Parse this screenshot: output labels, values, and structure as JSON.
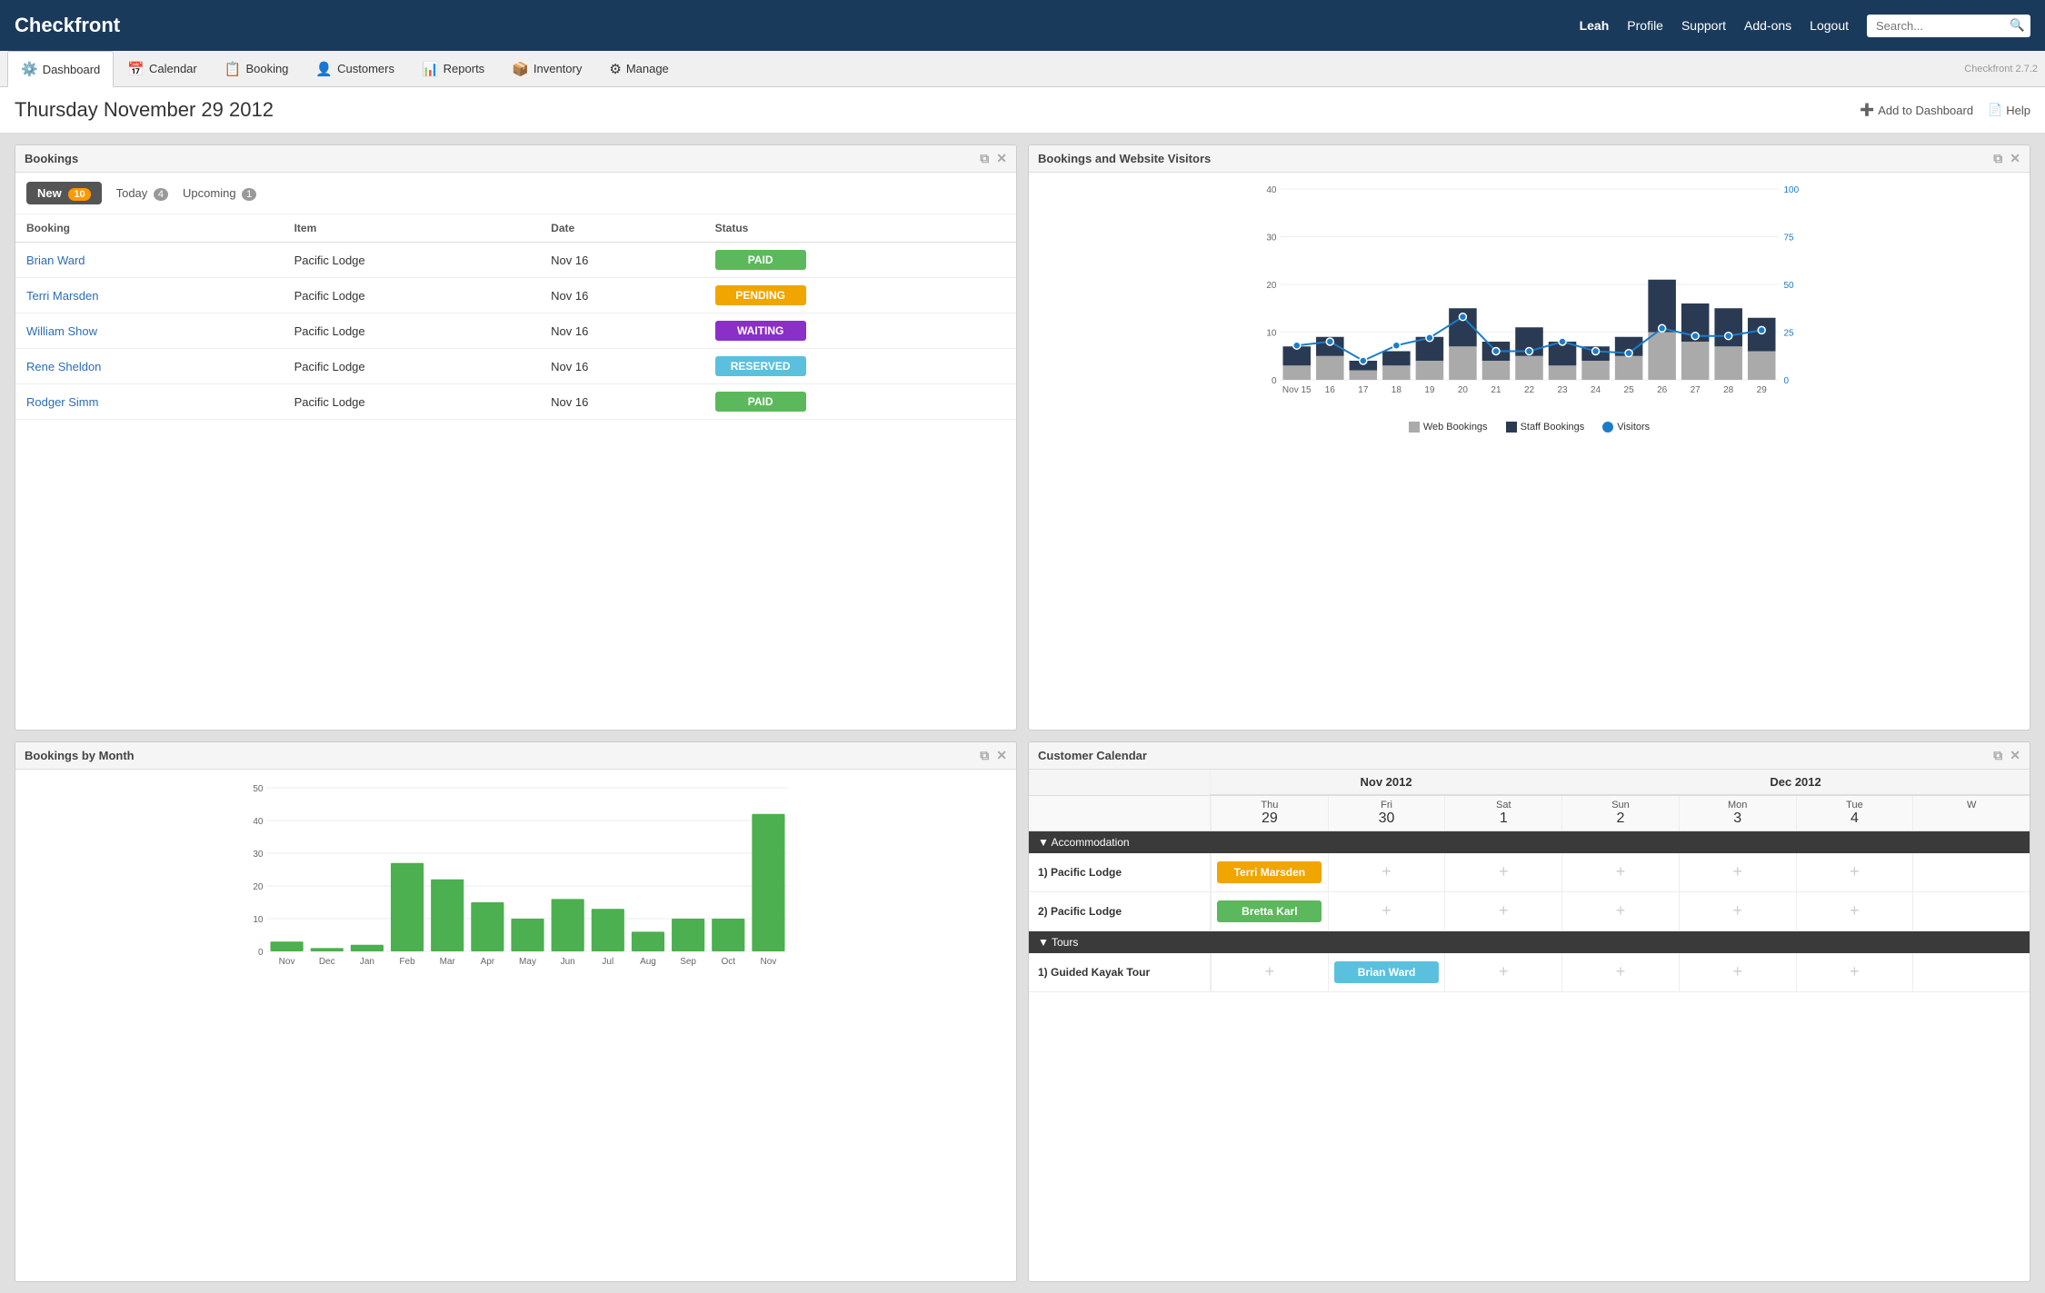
{
  "header": {
    "logo": "Checkfront",
    "username": "Leah",
    "nav": [
      "Profile",
      "Support",
      "Add-ons",
      "Logout"
    ],
    "search_placeholder": "Search..."
  },
  "navbar": {
    "tabs": [
      {
        "label": "Dashboard",
        "icon": "⚙",
        "active": true
      },
      {
        "label": "Calendar",
        "icon": "📅"
      },
      {
        "label": "Booking",
        "icon": "📋"
      },
      {
        "label": "Customers",
        "icon": "👤"
      },
      {
        "label": "Reports",
        "icon": "📊"
      },
      {
        "label": "Inventory",
        "icon": "📦"
      },
      {
        "label": "Manage",
        "icon": "⚙"
      }
    ],
    "version": "Checkfront 2.7.2"
  },
  "page": {
    "title": "Thursday November 29 2012",
    "add_to_dashboard": "Add to Dashboard",
    "help": "Help"
  },
  "bookings_widget": {
    "title": "Bookings",
    "tabs": [
      {
        "label": "New",
        "badge": "10",
        "active": true
      },
      {
        "label": "Today",
        "badge": "4"
      },
      {
        "label": "Upcoming",
        "badge": "1"
      }
    ],
    "columns": [
      "Booking",
      "Item",
      "Date",
      "Status"
    ],
    "rows": [
      {
        "booking": "Brian Ward",
        "item": "Pacific Lodge",
        "date": "Nov 16",
        "status": "PAID",
        "status_class": "status-paid"
      },
      {
        "booking": "Terri Marsden",
        "item": "Pacific Lodge",
        "date": "Nov 16",
        "status": "PENDING",
        "status_class": "status-pending"
      },
      {
        "booking": "William Show",
        "item": "Pacific Lodge",
        "date": "Nov 16",
        "status": "WAITING",
        "status_class": "status-waiting"
      },
      {
        "booking": "Rene Sheldon",
        "item": "Pacific Lodge",
        "date": "Nov 16",
        "status": "RESERVED",
        "status_class": "status-reserved"
      },
      {
        "booking": "Rodger Simm",
        "item": "Pacific Lodge",
        "date": "Nov 16",
        "status": "PAID",
        "status_class": "status-paid"
      }
    ]
  },
  "visitors_chart": {
    "title": "Bookings and Website Visitors",
    "labels": [
      "Nov 15",
      "16",
      "17",
      "18",
      "19",
      "20",
      "21",
      "22",
      "23",
      "24",
      "25",
      "26",
      "27",
      "28",
      "29"
    ],
    "left_axis": [
      0,
      10,
      20,
      30,
      40
    ],
    "right_axis": [
      0,
      25,
      50,
      75,
      100
    ],
    "legend": [
      "Web Bookings",
      "Staff Bookings",
      "Visitors"
    ],
    "bar_data_web": [
      3,
      5,
      2,
      3,
      4,
      7,
      4,
      5,
      3,
      4,
      5,
      10,
      8,
      7,
      6
    ],
    "bar_data_staff": [
      4,
      4,
      2,
      3,
      5,
      8,
      4,
      6,
      5,
      3,
      4,
      11,
      8,
      8,
      7
    ],
    "visitors_data": [
      18,
      20,
      10,
      18,
      22,
      33,
      15,
      15,
      20,
      15,
      14,
      27,
      23,
      23,
      26
    ]
  },
  "monthly_chart": {
    "title": "Bookings by Month",
    "labels": [
      "Nov",
      "Dec",
      "Jan",
      "Feb",
      "Mar",
      "Apr",
      "May",
      "Jun",
      "Jul",
      "Aug",
      "Sep",
      "Oct",
      "Nov"
    ],
    "values": [
      3,
      1,
      2,
      27,
      22,
      15,
      10,
      16,
      13,
      6,
      10,
      10,
      42
    ],
    "y_axis": [
      0,
      10,
      20,
      30,
      40,
      50
    ]
  },
  "customer_calendar": {
    "title": "Customer Calendar",
    "month1": "Nov 2012",
    "month2": "Dec 2012",
    "days": [
      {
        "day": "Thu",
        "date": "29"
      },
      {
        "day": "Fri",
        "date": "30"
      },
      {
        "day": "Sat",
        "date": "1"
      },
      {
        "day": "Sun",
        "date": "2"
      },
      {
        "day": "Mon",
        "date": "3"
      },
      {
        "day": "Tue",
        "date": "4"
      },
      {
        "day": "W",
        "date": ""
      }
    ],
    "sections": [
      {
        "name": "Accommodation",
        "rows": [
          {
            "label": "1) Pacific Lodge",
            "cells": [
              "Terri Marsden",
              "+",
              "+",
              "+",
              "+",
              "+",
              ""
            ],
            "cell_types": [
              "orange",
              "plus",
              "plus",
              "plus",
              "plus",
              "plus",
              ""
            ]
          },
          {
            "label": "2) Pacific Lodge",
            "cells": [
              "Bretta Karl",
              "+",
              "+",
              "+",
              "+",
              "+",
              ""
            ],
            "cell_types": [
              "green",
              "plus",
              "plus",
              "plus",
              "plus",
              "plus",
              ""
            ]
          }
        ]
      },
      {
        "name": "Tours",
        "rows": [
          {
            "label": "1) Guided Kayak Tour",
            "cells": [
              "+",
              "Brian Ward",
              "+",
              "+",
              "+",
              "+",
              ""
            ],
            "cell_types": [
              "plus",
              "blue",
              "plus",
              "plus",
              "plus",
              "plus",
              ""
            ]
          }
        ]
      }
    ]
  }
}
